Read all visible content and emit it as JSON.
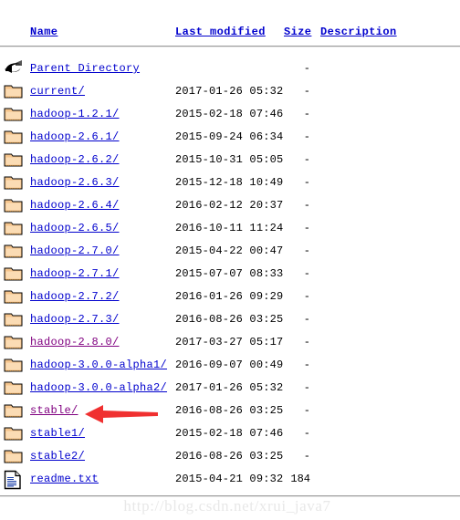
{
  "page": {
    "background_color": "#ffffff",
    "link_color": "#0000cd",
    "visited_link_color": "#800080",
    "text_color": "#000000",
    "arrow_color": "#f03030"
  },
  "header": {
    "name_label": "Name",
    "last_modified_label": "Last modified",
    "size_label": "Size",
    "description_label": "Description"
  },
  "rows": [
    {
      "icon": "parent-directory-icon",
      "name": "Parent Directory",
      "last_modified": "",
      "size": "-",
      "visited": false
    },
    {
      "icon": "folder-icon",
      "name": "current/",
      "last_modified": "2017-01-26 05:32",
      "size": "-",
      "visited": false
    },
    {
      "icon": "folder-icon",
      "name": "hadoop-1.2.1/",
      "last_modified": "2015-02-18 07:46",
      "size": "-",
      "visited": false
    },
    {
      "icon": "folder-icon",
      "name": "hadoop-2.6.1/",
      "last_modified": "2015-09-24 06:34",
      "size": "-",
      "visited": false
    },
    {
      "icon": "folder-icon",
      "name": "hadoop-2.6.2/",
      "last_modified": "2015-10-31 05:05",
      "size": "-",
      "visited": false
    },
    {
      "icon": "folder-icon",
      "name": "hadoop-2.6.3/",
      "last_modified": "2015-12-18 10:49",
      "size": "-",
      "visited": false
    },
    {
      "icon": "folder-icon",
      "name": "hadoop-2.6.4/",
      "last_modified": "2016-02-12 20:37",
      "size": "-",
      "visited": false
    },
    {
      "icon": "folder-icon",
      "name": "hadoop-2.6.5/",
      "last_modified": "2016-10-11 11:24",
      "size": "-",
      "visited": false
    },
    {
      "icon": "folder-icon",
      "name": "hadoop-2.7.0/",
      "last_modified": "2015-04-22 00:47",
      "size": "-",
      "visited": false
    },
    {
      "icon": "folder-icon",
      "name": "hadoop-2.7.1/",
      "last_modified": "2015-07-07 08:33",
      "size": "-",
      "visited": false
    },
    {
      "icon": "folder-icon",
      "name": "hadoop-2.7.2/",
      "last_modified": "2016-01-26 09:29",
      "size": "-",
      "visited": false
    },
    {
      "icon": "folder-icon",
      "name": "hadoop-2.7.3/",
      "last_modified": "2016-08-26 03:25",
      "size": "-",
      "visited": false
    },
    {
      "icon": "folder-icon",
      "name": "hadoop-2.8.0/",
      "last_modified": "2017-03-27 05:17",
      "size": "-",
      "visited": true
    },
    {
      "icon": "folder-icon",
      "name": "hadoop-3.0.0-alpha1/",
      "last_modified": "2016-09-07 00:49",
      "size": "-",
      "visited": false
    },
    {
      "icon": "folder-icon",
      "name": "hadoop-3.0.0-alpha2/",
      "last_modified": "2017-01-26 05:32",
      "size": "-",
      "visited": false
    },
    {
      "icon": "folder-icon",
      "name": "stable/",
      "last_modified": "2016-08-26 03:25",
      "size": "-",
      "visited": true
    },
    {
      "icon": "folder-icon",
      "name": "stable1/",
      "last_modified": "2015-02-18 07:46",
      "size": "-",
      "visited": false
    },
    {
      "icon": "folder-icon",
      "name": "stable2/",
      "last_modified": "2016-08-26 03:25",
      "size": "-",
      "visited": false
    },
    {
      "icon": "text-file-icon",
      "name": "readme.txt",
      "last_modified": "2015-04-21 09:32",
      "size": "184",
      "visited": false
    }
  ],
  "annotation": {
    "arrow": "red-left-arrow",
    "points_at": "stable/"
  },
  "watermark": {
    "text": "http://blog.csdn.net/xrui_java7"
  }
}
